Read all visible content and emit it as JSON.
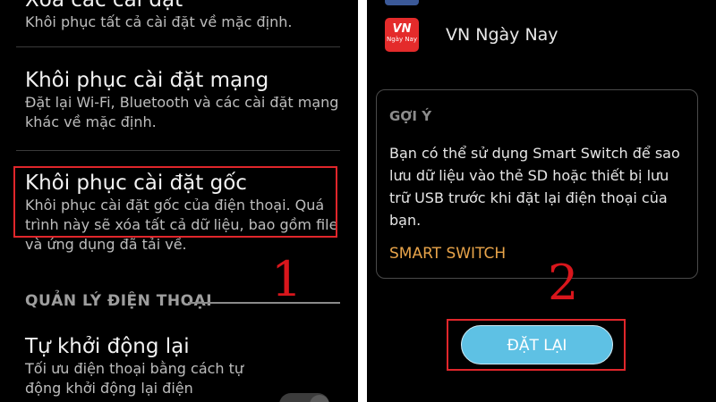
{
  "left_screen": {
    "reset_all": {
      "title": "Xóa các cài đặt",
      "description": "Khôi phục tất cả cài đặt về mặc định."
    },
    "reset_network": {
      "title": "Khôi phục cài đặt mạng",
      "description": "Đặt lại Wi-Fi, Bluetooth và các cài đặt mạng khác về mặc định."
    },
    "factory_reset": {
      "title": "Khôi phục cài đặt gốc",
      "description": "Khôi phục cài đặt gốc của điện thoại. Quá trình này sẽ xóa tất cả dữ liệu, bao gồm file và ứng dụng đã tải về."
    },
    "section_header": "QUẢN LÝ ĐIỆN THOẠI",
    "auto_restart": {
      "title": "Tự khởi động lại",
      "description": "Tối ưu điện thoại bằng cách tự động khởi động lại điện"
    },
    "step_number": "1"
  },
  "right_screen": {
    "app": {
      "icon_text": "VN",
      "icon_subtext": "Ngày Nay",
      "label": "VN Ngày Nay"
    },
    "tip": {
      "heading": "GỢI Ý",
      "body": "Bạn có thể sử dụng Smart Switch để sao lưu dữ liệu vào thẻ SD hoặc thiết bị lưu trữ USB trước khi đặt lại điện thoại của bạn.",
      "link": "SMART SWITCH"
    },
    "reset_button": "ĐẶT LẠI",
    "step_number": "2"
  },
  "colors": {
    "background": "#000000",
    "highlight": "#e0262b",
    "step_number": "#d8161c",
    "accent_link": "#e8a44a",
    "button": "#5ec1e4"
  }
}
